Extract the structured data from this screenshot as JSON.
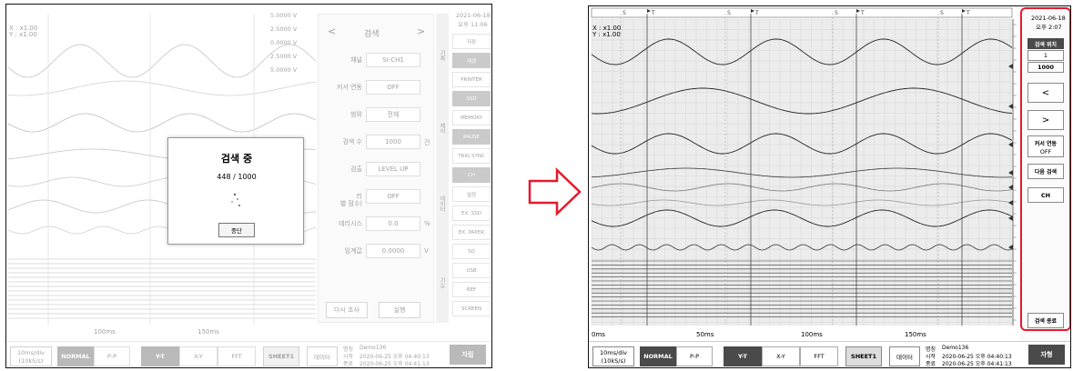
{
  "left_screen": {
    "zoom": {
      "x": "X : x1.00",
      "y": "Y : x1.00"
    },
    "datetime": {
      "date": "2021-06-18",
      "time": "오후 11:06"
    },
    "volt_labels": [
      "5.0000 V",
      "2.5000 V",
      "0.0000 V",
      "2.5000 V",
      "5.0000 V"
    ],
    "time_labels": [
      "100ms",
      "150ms"
    ],
    "search_panel": {
      "title": "검색",
      "prev_arrow": "<",
      "next_arrow": ">",
      "fields": [
        {
          "label": "채널",
          "value": "SI-CH1",
          "unit": ""
        },
        {
          "label": "커서 연동",
          "value": "OFF",
          "unit": ""
        },
        {
          "label": "범위",
          "value": "전체",
          "unit": ""
        },
        {
          "label": "검색 수",
          "value": "1000",
          "unit": "건"
        },
        {
          "label": "검출",
          "value": "LEVEL UP",
          "unit": ""
        },
        {
          "label": "리\n별 점수)",
          "value": "OFF",
          "unit": ""
        },
        {
          "label": "테리시스",
          "value": "0.0",
          "unit": "%"
        },
        {
          "label": "임계값",
          "value": "0.0000",
          "unit": "V"
        }
      ],
      "prev_search_button": "다시 조사",
      "execute_button": "실행"
    },
    "side_tabs": [
      "기록",
      "제어",
      "데이터",
      "기능"
    ],
    "side_buttons": [
      "저장",
      "재생",
      "PRINTER",
      "SSD",
      "MEMORY",
      "PAUSE",
      "TRIG SYNC",
      "CH",
      "설정",
      "EX. SSD",
      "EX. PAPER",
      "SD",
      "USB",
      "REF",
      "SCREEN"
    ],
    "dialog": {
      "title": "검색 중",
      "progress": "448 / 1000",
      "cancel_button": "중단"
    },
    "bottom": {
      "timebase": "10ms/div\n(10kS/s)",
      "modes": [
        "NORMAL",
        "P-P"
      ],
      "views": [
        "Y-T",
        "X-Y",
        "FFT"
      ],
      "sheet": "SHEET1",
      "data_button": "데이터",
      "name_label": "명칭",
      "name_value": "Demo136",
      "start_label": "시작",
      "start_value": "2020-06-25 오후 04:40:13",
      "end_label": "종료",
      "end_value": "2020-06-25 오후 04:41:13",
      "record_button": "자립"
    }
  },
  "right_screen": {
    "zoom": {
      "x": "X : x1.00",
      "y": "Y : x1.00"
    },
    "datetime": {
      "date": "2021-06-18",
      "time": "오후 2:07"
    },
    "time_labels": [
      "0ms",
      "50ms",
      "100ms",
      "150ms"
    ],
    "marker_s": "S",
    "marker_t": "T",
    "search_panel": {
      "position_title": "검색 위치",
      "position_current": "1",
      "position_total": "1000",
      "prev_button": "<",
      "next_button": ">",
      "cursor_label": "커서 연동",
      "cursor_value": "OFF",
      "next_search_button": "다음 검색",
      "ch_button": "CH",
      "end_button": "검색 종료"
    },
    "bottom": {
      "timebase": "10ms/div\n(10kS/s)",
      "modes": [
        "NORMAL",
        "P-P"
      ],
      "views": [
        "Y-T",
        "X-Y",
        "FFT"
      ],
      "sheet": "SHEET1",
      "data_button": "데이터",
      "name_label": "명칭",
      "name_value": "Demo136",
      "start_label": "시작",
      "start_value": "2020-06-25 오후 04:40:13",
      "end_label": "종료",
      "end_value": "2020-06-25 오후 04:41:13",
      "record_button": "자형"
    }
  },
  "colors": {
    "highlight": "#e8192c",
    "arrow_fill": "#ffffff",
    "arrow_stroke": "#e8192c",
    "dark_button": "#4a4a4a",
    "grid_bg": "#ececec"
  }
}
